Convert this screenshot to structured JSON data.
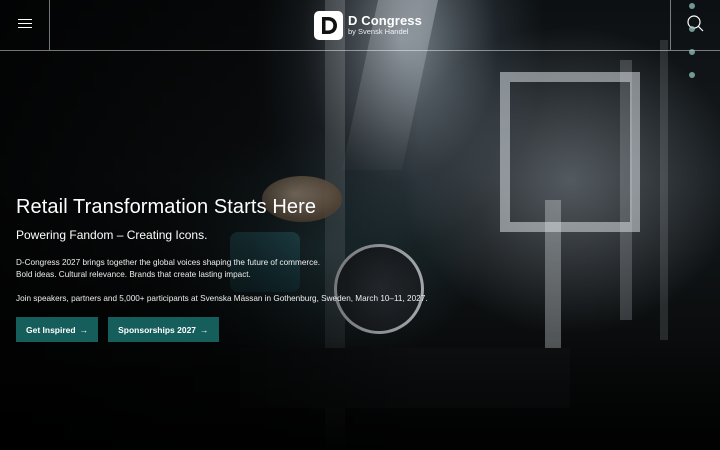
{
  "header": {
    "menu_icon": "hamburger-menu-icon",
    "search_icon": "search-icon",
    "logo": {
      "title": "D Congress",
      "subtitle": "by Svensk Handel"
    }
  },
  "hero": {
    "title": "Retail Transformation Starts Here",
    "tagline": "Powering Fandom – Creating Icons.",
    "description_line1": "D-Congress 2027 brings together the global voices shaping the future of commerce.",
    "description_line2": "Bold ideas. Cultural relevance. Brands that create lasting impact.",
    "join_text": "Join speakers, partners and 5,000+ participants at Svenska Mässan in Gothenburg, Sweden, March 10–11, 2027.",
    "buttons": [
      {
        "label": "Get Inspired",
        "arrow": "→"
      },
      {
        "label": "Sponsorships 2027",
        "arrow": "→"
      }
    ]
  },
  "colors": {
    "accent": "#155e5c",
    "slide_dot": "#96c3be"
  }
}
